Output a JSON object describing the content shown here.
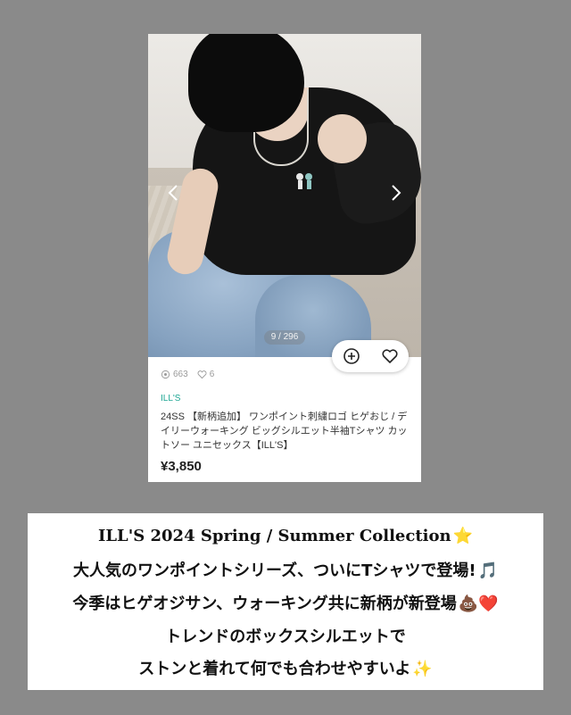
{
  "product": {
    "image_counter": "9 / 296",
    "views": "663",
    "likes": "6",
    "brand": "ILL'S",
    "title": "24SS 【新柄追加】 ワンポイント刺繍ロゴ ヒゲおじ / デイリーウォーキング ビッグシルエット半袖Tシャツ カットソー ユニセックス【ILL'S】",
    "price": "¥3,850"
  },
  "icons": {
    "prev": "chevron-left-icon",
    "next": "chevron-right-icon",
    "add": "plus-circle-icon",
    "like": "heart-icon",
    "views": "eye-icon",
    "likes": "heart-outline-icon"
  },
  "caption": {
    "line1": "ILL'S  2024 Spring / Summer Collection",
    "line1_emoji": "⭐",
    "line2": "大人気のワンポイントシリーズ、ついにTシャツで登場!",
    "line2_emoji": "🎵",
    "line3": "今季はヒゲオジサン、ウォーキング共に新柄が新登場",
    "line3_emoji": "💩❤️",
    "line4": "トレンドのボックスシルエットで",
    "line5": "ストンと着れて何でも合わせやすいよ",
    "line5_emoji": "✨"
  },
  "colors": {
    "background": "#8a8a8a",
    "brand": "#1ba592"
  }
}
